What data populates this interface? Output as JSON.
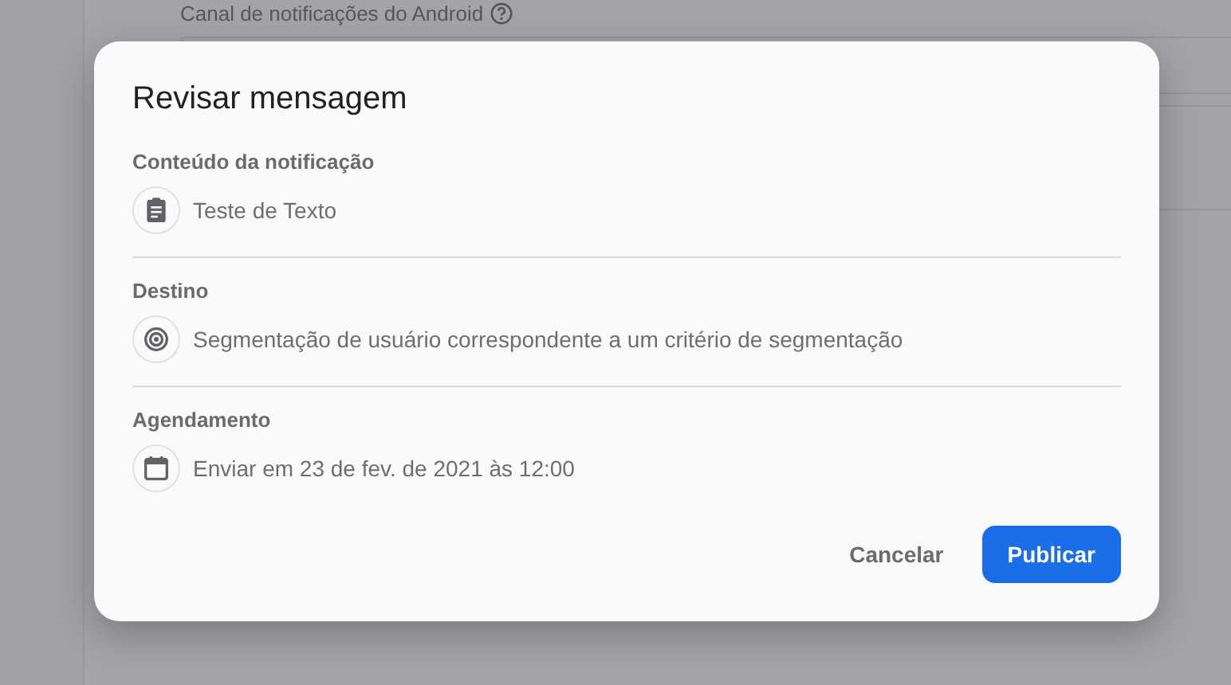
{
  "background": {
    "field_label": "Canal de notificações do Android"
  },
  "dialog": {
    "title": "Revisar mensagem",
    "sections": [
      {
        "kind": "content",
        "heading": "Conteúdo da notificação",
        "value": "Teste de Texto"
      },
      {
        "kind": "target",
        "heading": "Destino",
        "value": "Segmentação de usuário correspondente a um critério de segmentação"
      },
      {
        "kind": "schedule",
        "heading": "Agendamento",
        "value": "Enviar em 23 de fev. de 2021 às 12:00"
      }
    ],
    "buttons": [
      {
        "kind": "text",
        "label": "Cancelar"
      },
      {
        "kind": "primary",
        "label": "Publicar"
      }
    ]
  }
}
